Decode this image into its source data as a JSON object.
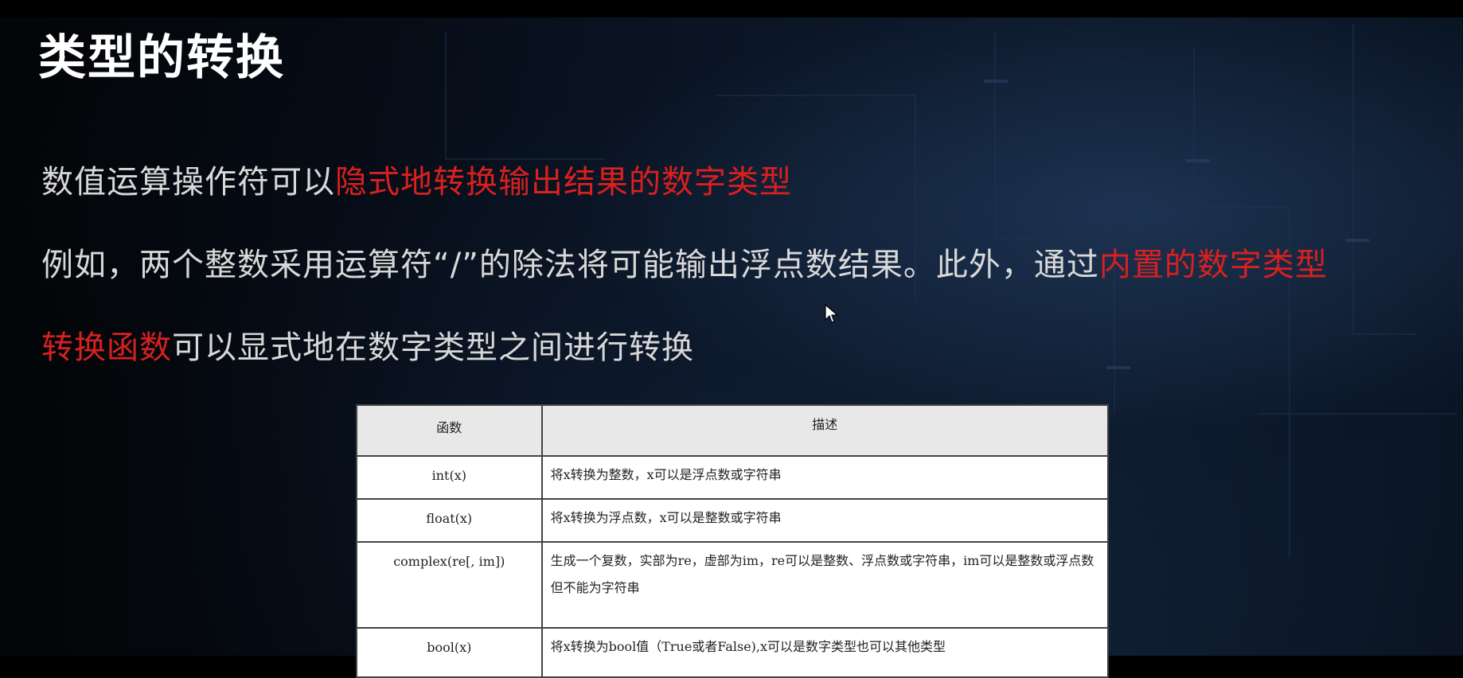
{
  "slide": {
    "title": "类型的转换",
    "line1": {
      "normal": "数值运算操作符可以",
      "highlight": "隐式地转换输出结果的数字类型"
    },
    "line2": {
      "normal": "例如，两个整数采用运算符“/”的除法将可能输出浮点数结果。此外，通过",
      "highlight": "内置的数字类型"
    },
    "line3": {
      "highlight": "转换函数",
      "normal": "可以显式地在数字类型之间进行转换"
    }
  },
  "table": {
    "headers": [
      "函数",
      "描述"
    ],
    "rows": [
      {
        "func": "int(x)",
        "desc": "将x转换为整数，x可以是浮点数或字符串"
      },
      {
        "func": "float(x)",
        "desc": "将x转换为浮点数，x可以是整数或字符串"
      },
      {
        "func": "complex(re[, im])",
        "desc": "生成一个复数，实部为re，虚部为im，re可以是整数、浮点数或字符串，im可以是整数或浮点数但不能为字符串"
      },
      {
        "func": "bool(x)",
        "desc": "将x转换为bool值（True或者False),x可以是数字类型也可以其他类型"
      }
    ]
  },
  "colors": {
    "highlight": "#d9201f",
    "text": "#d8d8d8",
    "title": "#ffffff"
  },
  "icons": {
    "cursor": "mouse-pointer-icon"
  }
}
